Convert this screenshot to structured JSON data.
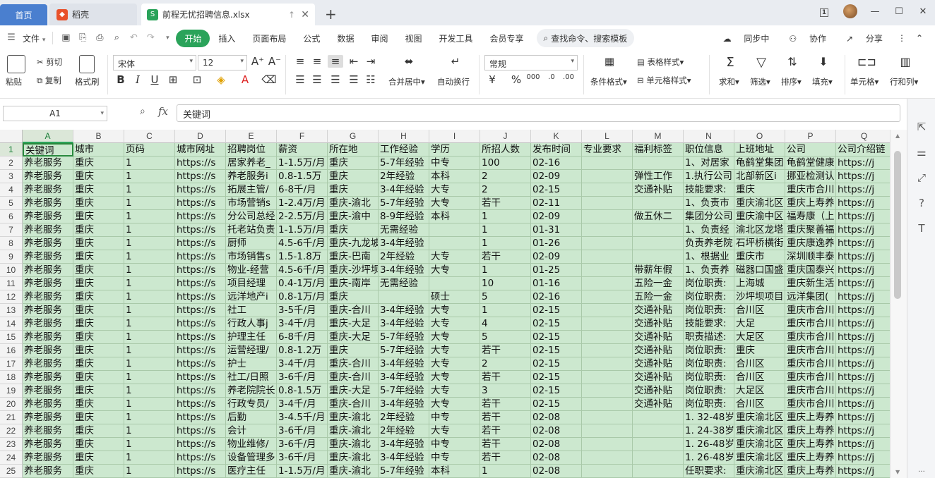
{
  "tabs": {
    "home": "首页",
    "docer": "稻壳",
    "file": "前程无忧招聘信息.xlsx"
  },
  "window": {
    "badge": "1"
  },
  "menu": {
    "file": "文件",
    "items": [
      "开始",
      "插入",
      "页面布局",
      "公式",
      "数据",
      "审阅",
      "视图",
      "开发工具",
      "会员专享"
    ],
    "search": "查找命令、搜索模板",
    "sync": "同步中",
    "collab": "协作",
    "share": "分享"
  },
  "ribbon": {
    "paste": "粘贴",
    "cut": "剪切",
    "copy": "复制",
    "format_painter": "格式刷",
    "font_name": "宋体",
    "font_size": "12",
    "merge_center": "合并居中",
    "wrap": "自动换行",
    "number_format": "常规",
    "percent": "%",
    "thousands": "000",
    "cond_format": "条件格式",
    "table_style": "表格样式",
    "cell_style": "单元格样式",
    "sum": "求和",
    "filter": "筛选",
    "sort": "排序",
    "fill": "填充",
    "cell": "单元格",
    "row_col": "行和列"
  },
  "formula": {
    "namebox": "A1",
    "fx": "fx",
    "value": "关键词"
  },
  "columns": [
    "A",
    "B",
    "C",
    "D",
    "E",
    "F",
    "G",
    "H",
    "I",
    "J",
    "K",
    "L",
    "M",
    "N",
    "O",
    "P",
    "Q"
  ],
  "rows": [
    [
      "关键词",
      "城市",
      "页码",
      "城市网址",
      "招聘岗位",
      "薪资",
      "所在地",
      "工作经验",
      "学历",
      "所招人数",
      "发布时间",
      "专业要求",
      "福利标签",
      "职位信息",
      "上班地址",
      "公司",
      "公司介绍链"
    ],
    [
      "养老服务",
      "重庆",
      "1",
      "https://s",
      "居家养老_",
      "1-1.5万/月",
      "重庆",
      "5-7年经验",
      "中专",
      "100",
      "02-16",
      "",
      "",
      "1、对居家",
      "龟鹤堂集团",
      "龟鹤堂健康",
      "https://j"
    ],
    [
      "养老服务",
      "重庆",
      "1",
      "https://s",
      "养老服务i",
      "0.8-1.5万",
      "重庆",
      "2年经验",
      "本科",
      "2",
      "02-09",
      "",
      "弹性工作",
      "1.执行公司",
      "北部新区i",
      "挪亚检测认",
      "https://j"
    ],
    [
      "养老服务",
      "重庆",
      "1",
      "https://s",
      "拓展主管/",
      "6-8千/月",
      "重庆",
      "3-4年经验",
      "大专",
      "2",
      "02-15",
      "",
      "交通补贴",
      "技能要求:",
      "重庆",
      "重庆市合川",
      "https://j"
    ],
    [
      "养老服务",
      "重庆",
      "1",
      "https://s",
      "市场营销s",
      "1-2.4万/月",
      "重庆-渝北",
      "5-7年经验",
      "大专",
      "若干",
      "02-11",
      "",
      "",
      "1、负责市",
      "重庆渝北区",
      "重庆上寿养",
      "https://j"
    ],
    [
      "养老服务",
      "重庆",
      "1",
      "https://s",
      "分公司总经",
      "2-2.5万/月",
      "重庆-渝中",
      "8-9年经验",
      "本科",
      "1",
      "02-09",
      "",
      "做五休二",
      "集团分公司",
      "重庆渝中区",
      "福寿康（上",
      "https://j"
    ],
    [
      "养老服务",
      "重庆",
      "1",
      "https://s",
      "托老站负责",
      "1-1.5万/月",
      "重庆",
      "无需经验",
      "",
      "1",
      "01-31",
      "",
      "",
      "1、负责经",
      "渝北区龙塔",
      "重庆聚善福",
      "https://j"
    ],
    [
      "养老服务",
      "重庆",
      "1",
      "https://s",
      "厨师",
      "4.5-6千/月",
      "重庆-九龙坡",
      "3-4年经验",
      "",
      "1",
      "01-26",
      "",
      "",
      "负责养老院",
      "石坪桥横街",
      "重庆康逸养",
      "https://j"
    ],
    [
      "养老服务",
      "重庆",
      "1",
      "https://s",
      "市场销售s",
      "1.5-1.8万",
      "重庆-巴南",
      "2年经验",
      "大专",
      "若干",
      "02-09",
      "",
      "",
      "1、根据业",
      "重庆市",
      "深圳顺丰泰",
      "https://j"
    ],
    [
      "养老服务",
      "重庆",
      "1",
      "https://s",
      "物业-经营",
      "4.5-6千/月",
      "重庆-沙坪坝",
      "3-4年经验",
      "大专",
      "1",
      "01-25",
      "",
      "带薪年假",
      "1、负责养",
      "磁器口国盛",
      "重庆国泰兴",
      "https://j"
    ],
    [
      "养老服务",
      "重庆",
      "1",
      "https://s",
      "项目经理",
      "0.4-1万/月",
      "重庆-南岸",
      "无需经验",
      "",
      "10",
      "01-16",
      "",
      "五险一金",
      "岗位职责:",
      "上海城",
      "重庆新生活",
      "https://j"
    ],
    [
      "养老服务",
      "重庆",
      "1",
      "https://s",
      "远洋地产i",
      "0.8-1万/月",
      "重庆",
      "",
      "硕士",
      "5",
      "02-16",
      "",
      "五险一金",
      "岗位职责:",
      "沙坪坝项目",
      "远洋集团(",
      "https://j"
    ],
    [
      "养老服务",
      "重庆",
      "1",
      "https://s",
      "社工",
      "3-5千/月",
      "重庆-合川",
      "3-4年经验",
      "大专",
      "1",
      "02-15",
      "",
      "交通补贴",
      "岗位职责:",
      "合川区",
      "重庆市合川",
      "https://j"
    ],
    [
      "养老服务",
      "重庆",
      "1",
      "https://s",
      "行政人事j",
      "3-4千/月",
      "重庆-大足",
      "3-4年经验",
      "大专",
      "4",
      "02-15",
      "",
      "交通补贴",
      "技能要求:",
      "大足",
      "重庆市合川",
      "https://j"
    ],
    [
      "养老服务",
      "重庆",
      "1",
      "https://s",
      "护理主任",
      "6-8千/月",
      "重庆-大足",
      "5-7年经验",
      "大专",
      "5",
      "02-15",
      "",
      "交通补贴",
      "职责描述:",
      "大足区",
      "重庆市合川",
      "https://j"
    ],
    [
      "养老服务",
      "重庆",
      "1",
      "https://s",
      "运营经理/",
      "0.8-1.2万",
      "重庆",
      "5-7年经验",
      "大专",
      "若干",
      "02-15",
      "",
      "交通补贴",
      "岗位职责:",
      "重庆",
      "重庆市合川",
      "https://j"
    ],
    [
      "养老服务",
      "重庆",
      "1",
      "https://s",
      "护士",
      "3-4千/月",
      "重庆-合川",
      "3-4年经验",
      "大专",
      "2",
      "02-15",
      "",
      "交通补贴",
      "岗位职责:",
      "合川区",
      "重庆市合川",
      "https://j"
    ],
    [
      "养老服务",
      "重庆",
      "1",
      "https://s",
      "社工/日照",
      "3-6千/月",
      "重庆-合川",
      "3-4年经验",
      "大专",
      "若干",
      "02-15",
      "",
      "交通补贴",
      "岗位职责:",
      "合川区",
      "重庆市合川",
      "https://j"
    ],
    [
      "养老服务",
      "重庆",
      "1",
      "https://s",
      "养老院院长",
      "0.8-1.5万",
      "重庆-大足",
      "5-7年经验",
      "大专",
      "3",
      "02-15",
      "",
      "交通补贴",
      "岗位职责:",
      "大足区",
      "重庆市合川",
      "https://j"
    ],
    [
      "养老服务",
      "重庆",
      "1",
      "https://s",
      "行政专员/",
      "3-4千/月",
      "重庆-合川",
      "3-4年经验",
      "大专",
      "若干",
      "02-15",
      "",
      "交通补贴",
      "岗位职责:",
      "合川区",
      "重庆市合川",
      "https://j"
    ],
    [
      "养老服务",
      "重庆",
      "1",
      "https://s",
      "后勤",
      "3-4.5千/月",
      "重庆-渝北",
      "2年经验",
      "中专",
      "若干",
      "02-08",
      "",
      "",
      "1. 32-48岁",
      "重庆渝北区",
      "重庆上寿养",
      "https://j"
    ],
    [
      "养老服务",
      "重庆",
      "1",
      "https://s",
      "会计",
      "3-6千/月",
      "重庆-渝北",
      "2年经验",
      "大专",
      "若干",
      "02-08",
      "",
      "",
      "1. 24-38岁",
      "重庆渝北区",
      "重庆上寿养",
      "https://j"
    ],
    [
      "养老服务",
      "重庆",
      "1",
      "https://s",
      "物业维修/",
      "3-6千/月",
      "重庆-渝北",
      "3-4年经验",
      "中专",
      "若干",
      "02-08",
      "",
      "",
      "1. 26-48岁",
      "重庆渝北区",
      "重庆上寿养",
      "https://j"
    ],
    [
      "养老服务",
      "重庆",
      "1",
      "https://s",
      "设备管理多",
      "3-6千/月",
      "重庆-渝北",
      "3-4年经验",
      "中专",
      "若干",
      "02-08",
      "",
      "",
      "1. 26-48岁",
      "重庆渝北区",
      "重庆上寿养",
      "https://j"
    ],
    [
      "养老服务",
      "重庆",
      "1",
      "https://s",
      "医疗主任",
      "1-1.5万/月",
      "重庆-渝北",
      "5-7年经验",
      "本科",
      "1",
      "02-08",
      "",
      "",
      "任职要求:",
      "重庆渝北区",
      "重庆上寿养",
      "https://j"
    ]
  ]
}
